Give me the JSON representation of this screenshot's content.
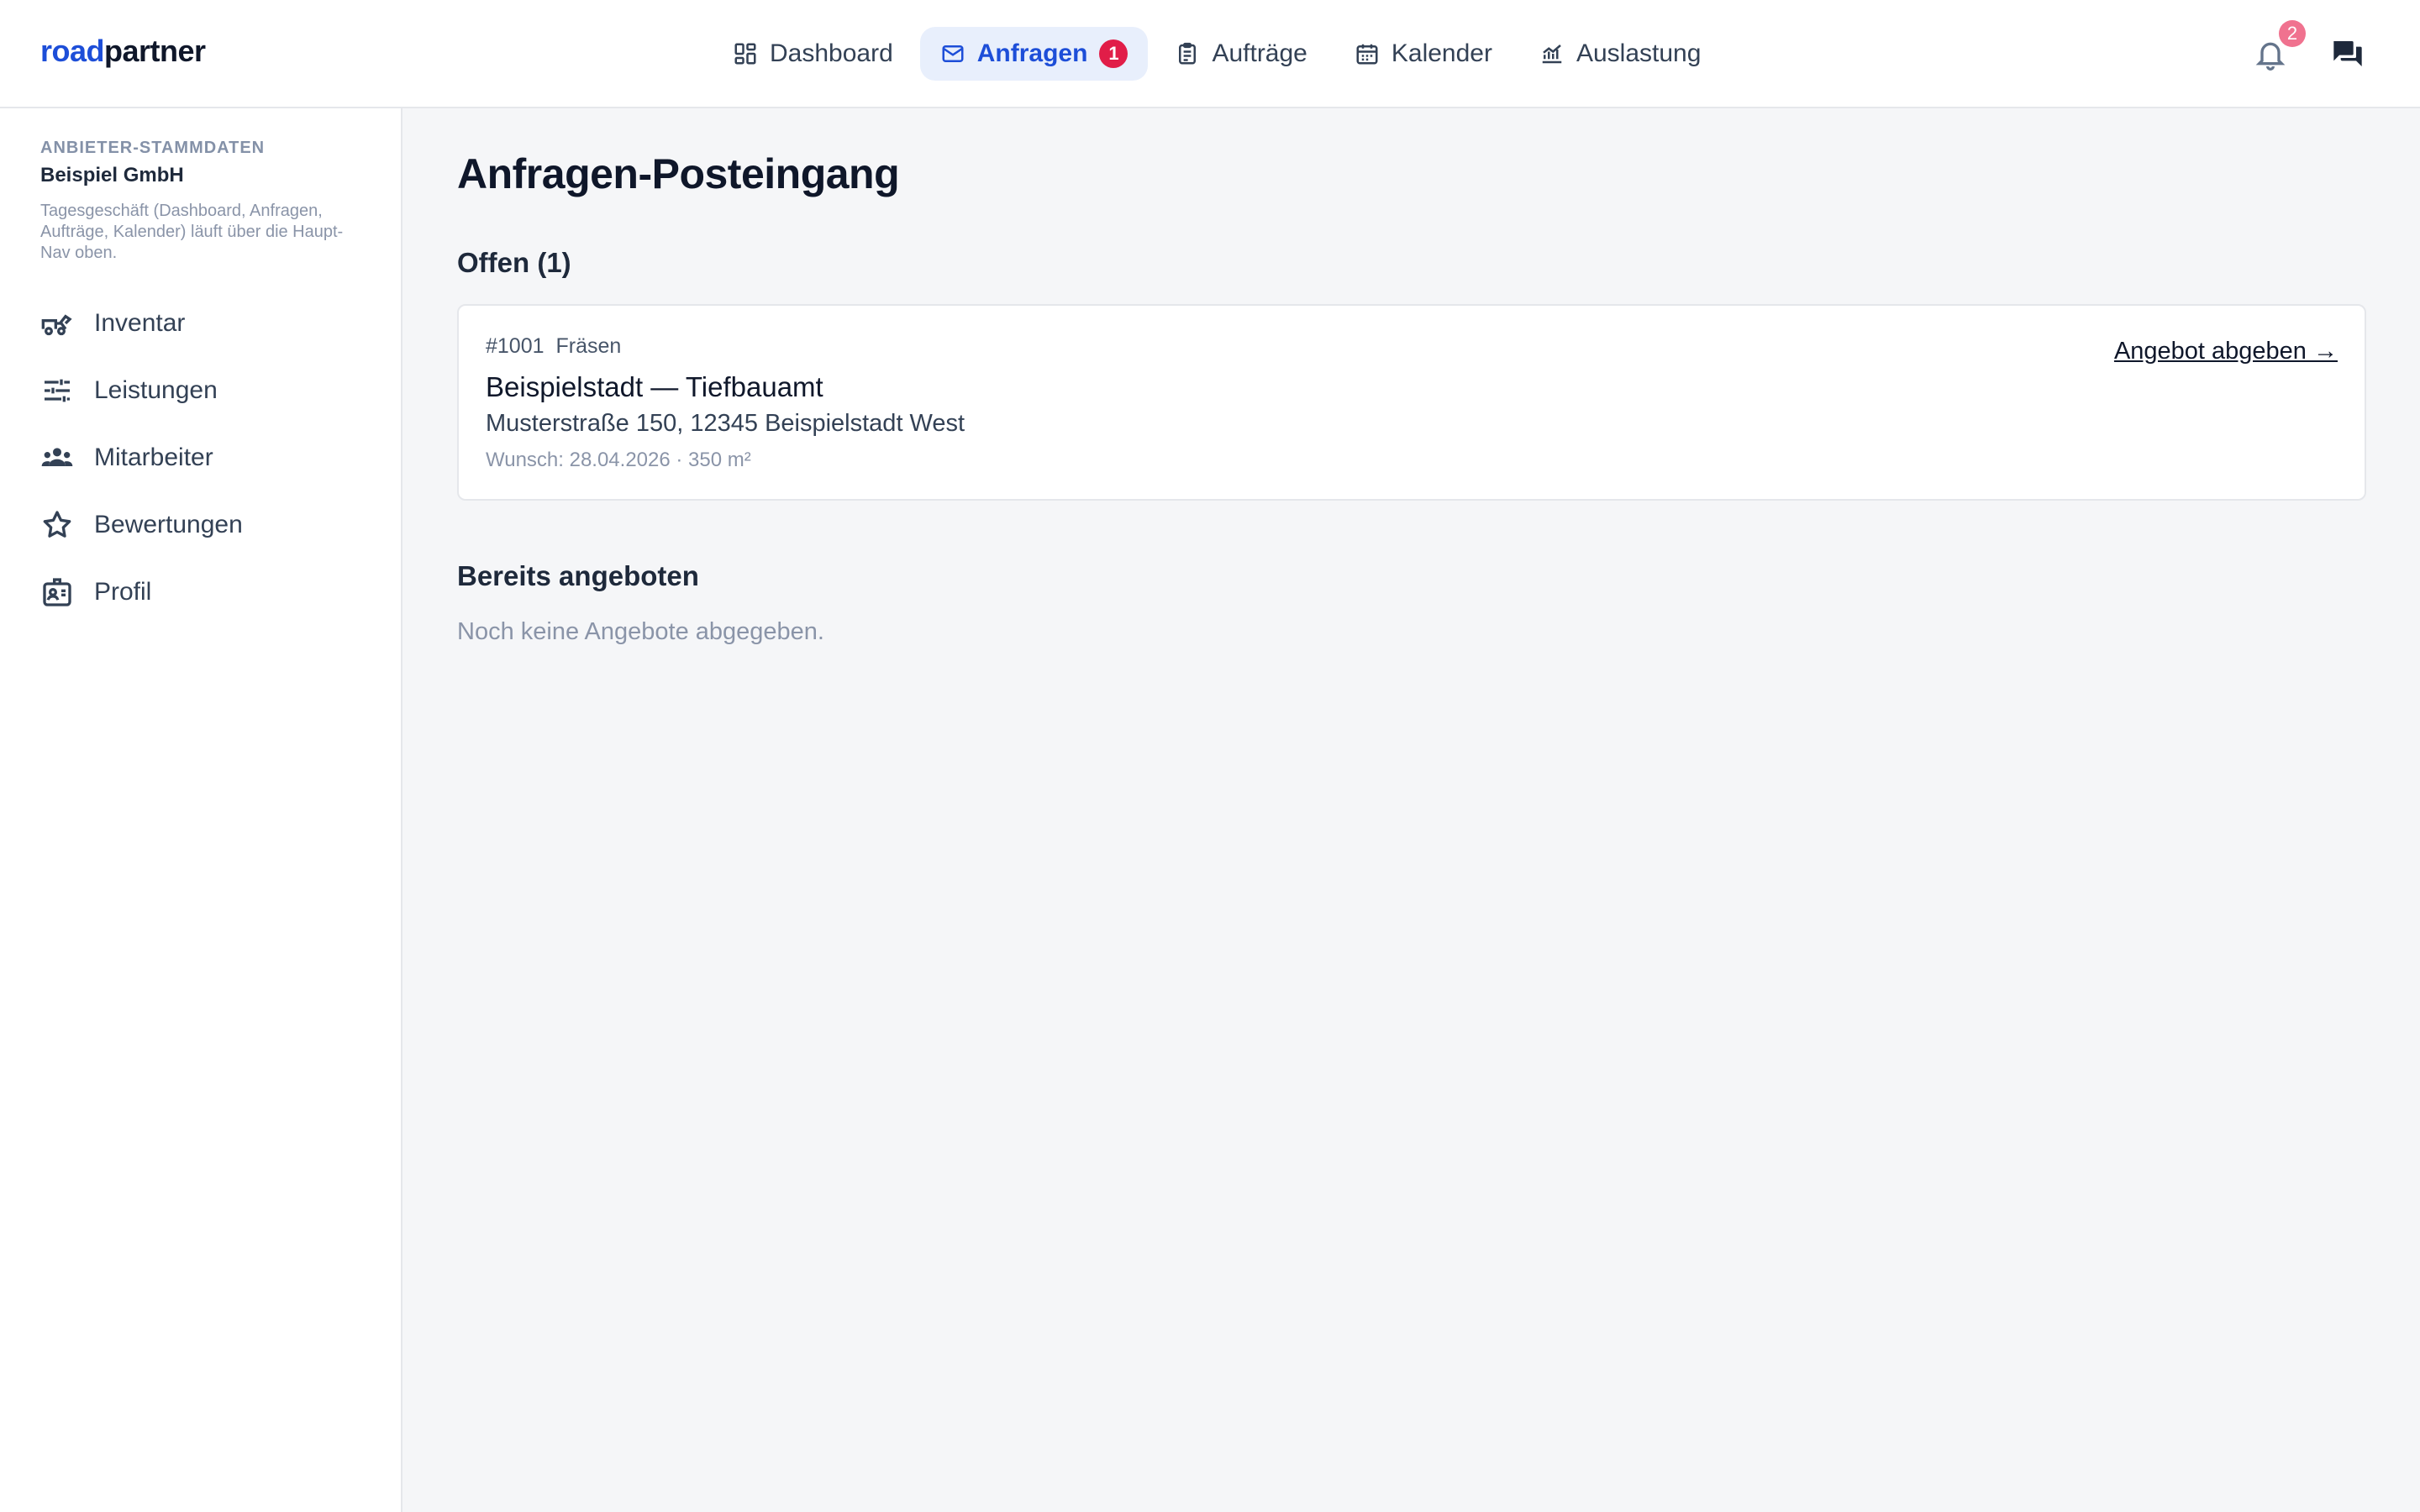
{
  "header": {
    "logo": {
      "part1": "road",
      "part2": "partner"
    },
    "nav": [
      {
        "label": "Dashboard",
        "icon": "dashboard-icon",
        "active": false
      },
      {
        "label": "Anfragen",
        "icon": "mail-icon",
        "active": true,
        "badge": "1"
      },
      {
        "label": "Aufträge",
        "icon": "clipboard-icon",
        "active": false
      },
      {
        "label": "Kalender",
        "icon": "calendar-icon",
        "active": false
      },
      {
        "label": "Auslastung",
        "icon": "chart-icon",
        "active": false
      }
    ],
    "notifications_badge": "2"
  },
  "sidebar": {
    "kicker": "ANBIETER-STAMMDATEN",
    "company": "Beispiel GmbH",
    "note": "Tagesgeschäft (Dashboard, Anfragen, Aufträge, Kalender) läuft über die Haupt-Nav oben.",
    "items": [
      {
        "label": "Inventar",
        "icon": "truck-icon"
      },
      {
        "label": "Leistungen",
        "icon": "sliders-icon"
      },
      {
        "label": "Mitarbeiter",
        "icon": "people-icon"
      },
      {
        "label": "Bewertungen",
        "icon": "star-icon"
      },
      {
        "label": "Profil",
        "icon": "id-card-icon"
      }
    ]
  },
  "main": {
    "title": "Anfragen-Posteingang",
    "open_section": "Offen (1)",
    "requests": [
      {
        "id": "#1001",
        "type": "Fräsen",
        "title": "Beispielstadt — Tiefbauamt",
        "address": "Musterstraße 150, 12345 Beispielstadt West",
        "wish": "Wunsch: 28.04.2026 · 350 m²",
        "action": "Angebot abgeben →"
      }
    ],
    "offered_section": "Bereits angeboten",
    "offered_empty": "Noch keine Angebote abgegeben."
  },
  "colors": {
    "accent": "#1d4ed8",
    "active_nav_bg": "#e8effc",
    "badge": "#e11d48",
    "notification_badge": "#f0728f",
    "page_bg": "#f5f6f8"
  }
}
